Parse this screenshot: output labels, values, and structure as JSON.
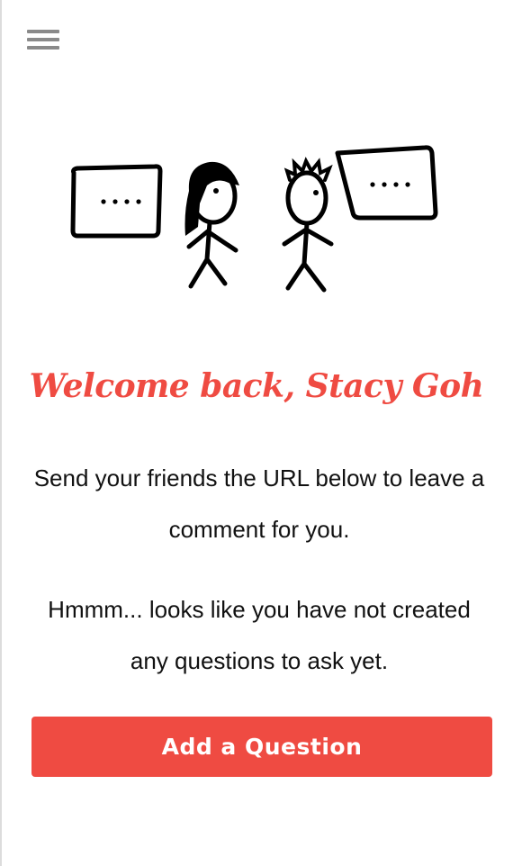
{
  "menu": {
    "icon": "hamburger-menu-icon"
  },
  "illustration": {
    "icon": "two-stick-figures-speech-bubbles"
  },
  "welcome": {
    "title": "Welcome back, Stacy Goh"
  },
  "content": {
    "share_text": "Send your friends the URL below to leave a comment for you.",
    "empty_text": "Hmmm... looks like you have not created any questions to ask yet."
  },
  "actions": {
    "add_question_label": "Add a Question"
  },
  "colors": {
    "accent": "#ef4b42",
    "menu_icon": "#8a8a8a",
    "text": "#111111",
    "background": "#ffffff"
  }
}
